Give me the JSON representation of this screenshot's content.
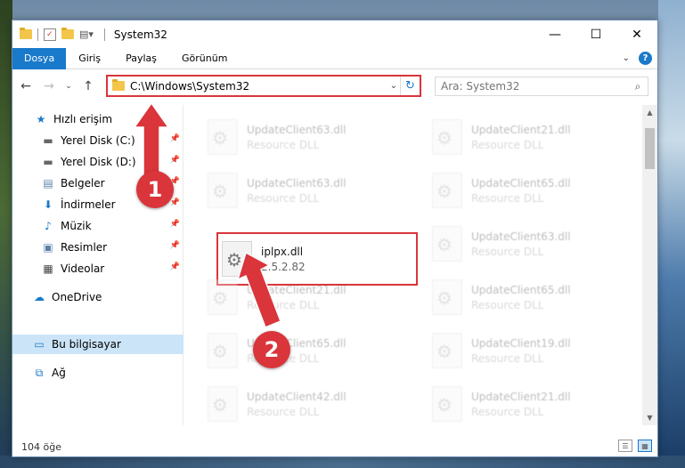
{
  "window": {
    "title": "System32",
    "minimize_glyph": "—",
    "maximize_glyph": "☐",
    "close_glyph": "✕"
  },
  "ribbon": {
    "tabs": [
      "Dosya",
      "Giriş",
      "Paylaş",
      "Görünüm"
    ],
    "help": "?"
  },
  "address": {
    "path": "C:\\Windows\\System32"
  },
  "search": {
    "placeholder": "Ara: System32"
  },
  "navpane": {
    "items": [
      {
        "label": "Hızlı erişim",
        "icon": "star-icon",
        "glyph": "★"
      },
      {
        "label": "Yerel Disk (C:)",
        "icon": "drive-icon",
        "glyph": "▬"
      },
      {
        "label": "Yerel Disk (D:)",
        "icon": "drive-icon",
        "glyph": "▬"
      },
      {
        "label": "Belgeler",
        "icon": "documents-icon",
        "glyph": "▤"
      },
      {
        "label": "İndirmeler",
        "icon": "download-icon",
        "glyph": "⬇"
      },
      {
        "label": "Müzik",
        "icon": "music-icon",
        "glyph": "♪"
      },
      {
        "label": "Resimler",
        "icon": "pictures-icon",
        "glyph": "▣"
      },
      {
        "label": "Videolar",
        "icon": "video-icon",
        "glyph": "▦"
      },
      {
        "label": "OneDrive",
        "icon": "cloud-icon",
        "glyph": "☁"
      },
      {
        "label": "Bu bilgisayar",
        "icon": "computer-icon",
        "glyph": "▭"
      },
      {
        "label": "Ağ",
        "icon": "network-icon",
        "glyph": "⧉"
      }
    ]
  },
  "files": [
    {
      "name": "UpdateClient63.dll",
      "sub": "Resource DLL"
    },
    {
      "name": "UpdateClient21.dll",
      "sub": "Resource DLL"
    },
    {
      "name": "UpdateClient63.dll",
      "sub": "Resource DLL"
    },
    {
      "name": "UpdateClient65.dll",
      "sub": "Resource DLL"
    },
    {
      "name": "iplpx.dll",
      "sub": "2.5.2.82"
    },
    {
      "name": "UpdateClient63.dll",
      "sub": "Resource DLL"
    },
    {
      "name": "UpdateClient21.dll",
      "sub": "Resource DLL"
    },
    {
      "name": "UpdateClient65.dll",
      "sub": "Resource DLL"
    },
    {
      "name": "UpdateClient65.dll",
      "sub": "Resource DLL"
    },
    {
      "name": "UpdateClient19.dll",
      "sub": "Resource DLL"
    },
    {
      "name": "UpdateClient42.dll",
      "sub": "Resource DLL"
    },
    {
      "name": "UpdateClient21.dll",
      "sub": "Resource DLL"
    }
  ],
  "status": {
    "count": "104 öğe"
  },
  "annotations": {
    "step1": "1",
    "step2": "2",
    "color": "#d9353b"
  },
  "colors": {
    "accent": "#1979ca",
    "highlight": "#d9353b",
    "selection": "#cce4f7"
  }
}
